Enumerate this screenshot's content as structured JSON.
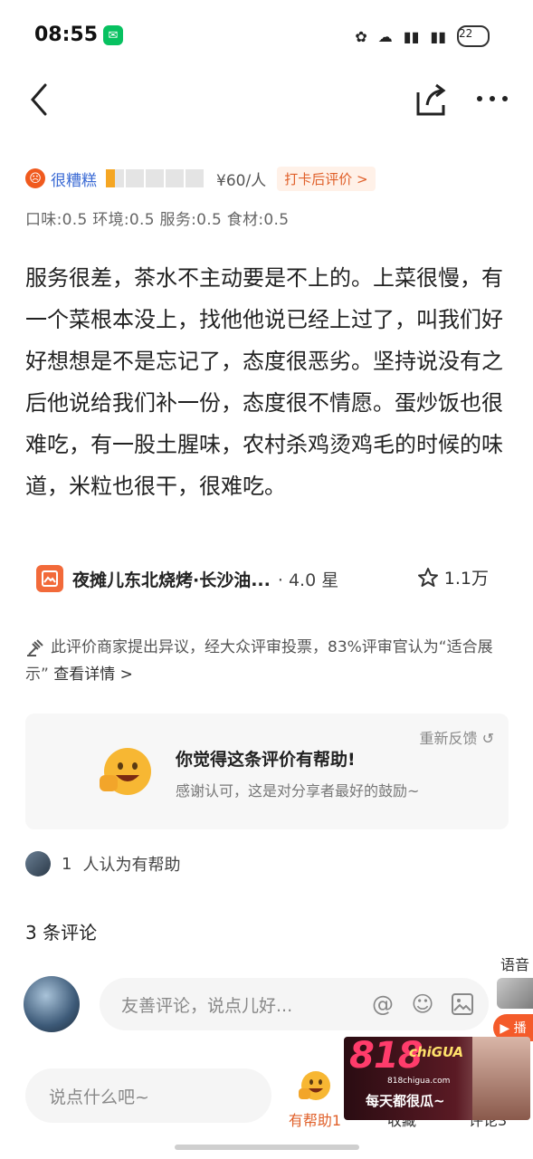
{
  "status_bar": {
    "time": "08:55",
    "battery": "22",
    "icons": [
      "flower-icon",
      "cloud-icon",
      "signal-icon",
      "signal-icon"
    ]
  },
  "nav": {
    "back_icon": "chevron-left-icon",
    "share_icon": "share-icon",
    "more_icon": "more-icon"
  },
  "rating": {
    "tag": "很糟糕",
    "stars": 0.5,
    "price": "¥60/人",
    "checkin": "打卡后评价 >",
    "sub_scores": "口味:0.5  环境:0.5  服务:0.5  食材:0.5"
  },
  "review": {
    "text": "服务很差，茶水不主动要是不上的。上菜很慢，有一个菜根本没上，找他他说已经上过了，叫我们好好想想是不是忘记了，态度很恶劣。坚持说没有之后他说给我们补一份，态度很不情愿。蛋炒饭也很难吃，有一股土腥味，农村杀鸡烫鸡毛的时候的味道，米粒也很干，很难吃。"
  },
  "shop": {
    "name": "夜摊儿东北烧烤·长沙油...",
    "rating": "· 4.0 星",
    "favorites": "1.1万"
  },
  "dispute": {
    "text": "此评价商家提出异议，经大众评审投票，83%评审官认为“适合展示”",
    "link": "查看详情 >"
  },
  "helpful_card": {
    "refeedback": "重新反馈",
    "title": "你觉得这条评价有帮助!",
    "subtitle": "感谢认可，这是对分享者最好的鼓励~"
  },
  "helpers": {
    "count": "1",
    "label": "人认为有帮助"
  },
  "comments": {
    "count_label": "3 条评论",
    "placeholder": "友善评论，说点儿好..."
  },
  "voice": {
    "label": "语音",
    "play": "▶ 播"
  },
  "bottom_bar": {
    "placeholder": "说点什么吧~",
    "helpful_label": "有帮助1",
    "fav_label": "收藏",
    "comment_label": "评论3"
  },
  "ad": {
    "logo": "818",
    "logo_small": "chiGUA",
    "url": "818chigua.com",
    "slogan": "每天都很瓜~"
  },
  "colors": {
    "accent": "#e0602a",
    "tag_blue": "#3a6ad4",
    "star": "#f5a623"
  }
}
